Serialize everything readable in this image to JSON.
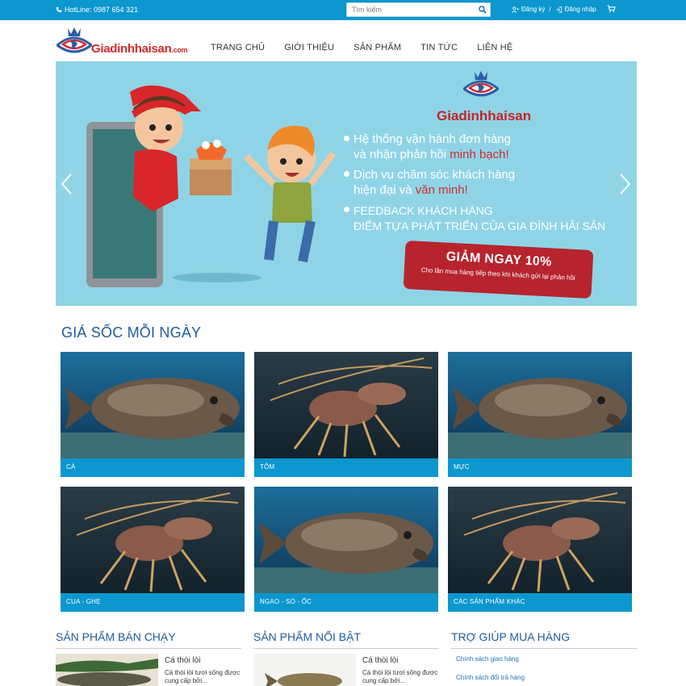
{
  "topbar": {
    "hotline": "HotLine: 0987 654 321",
    "search_placeholder": "Tìm kiếm",
    "register": "Đăng ký",
    "separator": "/",
    "login": "Đăng nhập"
  },
  "logo": {
    "name": "Giadinhhaisan",
    "domain": ".com"
  },
  "nav": [
    "TRANG CHỦ",
    "GIỚI THIỆU",
    "SẢN PHẨM",
    "TIN TỨC",
    "LIÊN HỆ"
  ],
  "banner": {
    "brand": "Giadinhhaisan",
    "line1a": "Hệ thống vận hành đơn hàng",
    "line1b": "và nhận phản hồi ",
    "line1b_hl": "minh bạch!",
    "line2a": "Dịch vụ chăm sóc khách hàng",
    "line2b": "hiện đại và ",
    "line2b_hl": "văn minh!",
    "line3a": "FEEDBACK KHÁCH HÀNG",
    "line3b": "ĐIỂM TỰA PHÁT TRIỂN CỦA GIA ĐÌNH HẢI SẢN",
    "promo_title": "GIẢM NGAY 10%",
    "promo_sub": "Cho lần mua hàng tiếp theo khi khách gửi lại phản hồi"
  },
  "deals_title": "GIÁ SỐC MỖI NGÀY",
  "categories": [
    {
      "label": "CÁ",
      "image": "grouper-fish"
    },
    {
      "label": "TÔM",
      "image": "lobster"
    },
    {
      "label": "MỰC",
      "image": "grouper-fish"
    },
    {
      "label": "CUA - GHẸ",
      "image": "lobster"
    },
    {
      "label": "NGAO - SÒ - ỐC",
      "image": "grouper-fish"
    },
    {
      "label": "CÁC SẢN PHẨM KHÁC",
      "image": "lobster"
    }
  ],
  "bestsellers": {
    "title": "SẢN PHẨM BÁN CHẠY",
    "item": {
      "name": "Cá thòi lòi",
      "desc": "Cá thòi lòi tươi sống được cung cấp bởi..."
    }
  },
  "featured": {
    "title": "SẢN PHẨM NỔI BẬT",
    "item": {
      "name": "Cá thòi lòi",
      "desc": "Cá thòi lòi tươi sống được cung cấp bởi..."
    }
  },
  "help": {
    "title": "TRỢ GIÚP MUA HÀNG",
    "links": [
      "Chính sách giao hàng",
      "Chính sách đổi trả hàng"
    ]
  },
  "colors": {
    "accent": "#0c97cf",
    "heading": "#1f5c9c",
    "brand_red": "#d4282e"
  }
}
